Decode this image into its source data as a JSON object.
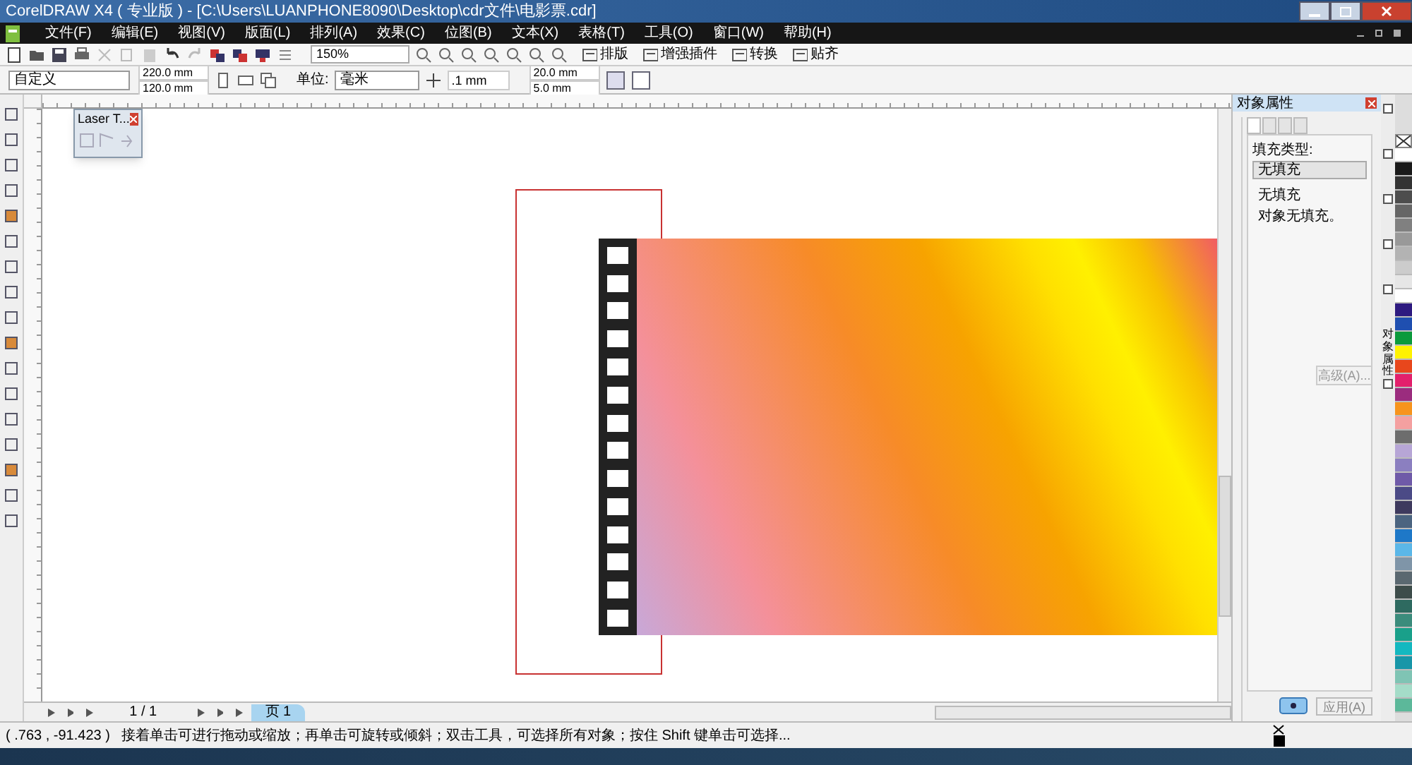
{
  "window": {
    "title": "CorelDRAW X4 ( 专业版 ) - [C:\\Users\\LUANPHONE8090\\Desktop\\cdr文件\\电影票.cdr]"
  },
  "menu": [
    "文件(F)",
    "编辑(E)",
    "视图(V)",
    "版面(L)",
    "排列(A)",
    "效果(C)",
    "位图(B)",
    "文本(X)",
    "表格(T)",
    "工具(O)",
    "窗口(W)",
    "帮助(H)"
  ],
  "toolbar": {
    "zoom": "150%",
    "plugins": [
      "排版",
      "增强插件",
      "转换",
      "贴齐"
    ]
  },
  "property_bar": {
    "page_size": "自定义",
    "width": "220.0 mm",
    "height": "120.0 mm",
    "unit_label": "单位:",
    "unit": "毫米",
    "nudge": ".1 mm",
    "dup_x": "20.0 mm",
    "dup_y": "5.0 mm"
  },
  "laser_window": {
    "title": "Laser T..."
  },
  "docker": {
    "title": "对象属性",
    "tabs": [
      {
        "selected": true
      },
      {
        "selected": false
      },
      {
        "selected": false
      },
      {
        "selected": false
      }
    ],
    "fill_label": "填充类型:",
    "fill_value": "无填充",
    "info_title": "无填充",
    "info_text": "对象无填充。",
    "advanced": "高级(A)...",
    "apply": "应用(A)",
    "side_tab": "对象属性"
  },
  "palette": [
    {
      "color": "#ffffff"
    },
    {
      "color": "#1a1a1a"
    },
    {
      "color": "#333333"
    },
    {
      "color": "#4d4d4d"
    },
    {
      "color": "#666666"
    },
    {
      "color": "#808080"
    },
    {
      "color": "#999999"
    },
    {
      "color": "#b3b3b3"
    },
    {
      "color": "#cccccc"
    },
    {
      "color": "#e6e6e6"
    },
    {
      "color": "#ffffff"
    },
    {
      "color": "#2e1a80"
    },
    {
      "color": "#1f4fb0"
    },
    {
      "color": "#0b9a3c"
    },
    {
      "color": "#fff200"
    },
    {
      "color": "#e8471c"
    },
    {
      "color": "#e3206c"
    },
    {
      "color": "#9b2c7e"
    },
    {
      "color": "#f7941d"
    },
    {
      "color": "#f4a0a0"
    },
    {
      "color": "#6d6d6d"
    },
    {
      "color": "#b7a6d6"
    },
    {
      "color": "#8b7fc0"
    },
    {
      "color": "#6f5aa8"
    },
    {
      "color": "#4b4a86"
    },
    {
      "color": "#3e3a5e"
    },
    {
      "color": "#4b6480"
    },
    {
      "color": "#1e78c8"
    },
    {
      "color": "#5bb7e8"
    },
    {
      "color": "#7f95a8"
    },
    {
      "color": "#5a6870"
    },
    {
      "color": "#3d4c4a"
    },
    {
      "color": "#2e6a60"
    },
    {
      "color": "#3b8c7c"
    },
    {
      "color": "#19a08a"
    },
    {
      "color": "#14b8c0"
    },
    {
      "color": "#1896a8"
    },
    {
      "color": "#7fc4b4"
    },
    {
      "color": "#a4dcc8"
    },
    {
      "color": "#5cb89a"
    }
  ],
  "page_nav": {
    "counter": "1 / 1",
    "tabs": [
      {
        "label": "页 1",
        "selected": true
      }
    ]
  },
  "status": {
    "coords": "( .763 , -91.423 )",
    "message": "接着单击可进行拖动或缩放；再单击可旋转或倾斜；双击工具，可选择所有对象；按住 Shift 键单击可选择..."
  }
}
